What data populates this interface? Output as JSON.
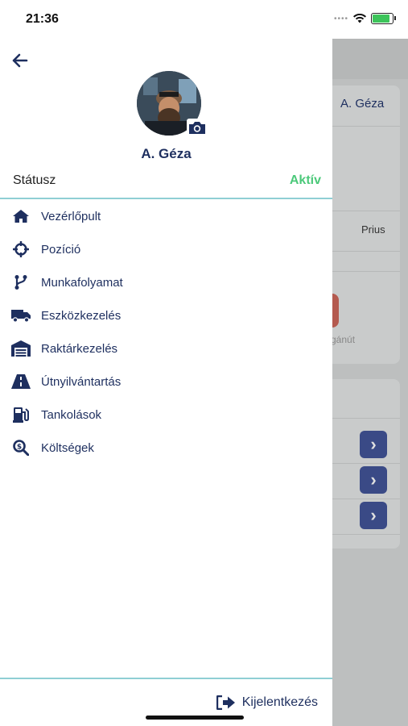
{
  "status_bar": {
    "time": "21:36"
  },
  "drawer": {
    "user_name": "A. Géza",
    "status_label": "Státusz",
    "status_value": "Aktív",
    "menu": [
      {
        "label": "Vezérlőpult",
        "icon": "home-icon"
      },
      {
        "label": "Pozíció",
        "icon": "crosshair-icon"
      },
      {
        "label": "Munkafolyamat",
        "icon": "workflow-icon"
      },
      {
        "label": "Eszközkezelés",
        "icon": "truck-icon"
      },
      {
        "label": "Raktárkezelés",
        "icon": "warehouse-icon"
      },
      {
        "label": "Útnyilvántartás",
        "icon": "road-icon"
      },
      {
        "label": "Tankolások",
        "icon": "fuel-icon"
      },
      {
        "label": "Költségek",
        "icon": "cost-search-icon"
      }
    ],
    "logout_label": "Kijelentkezés"
  },
  "background": {
    "header_name": "A. Géza",
    "vehicle": "Prius",
    "partial_text": "gánút",
    "partial_letter": "i"
  },
  "colors": {
    "primary": "#1e2f5f",
    "status_active": "#4cc97a",
    "divider": "#8fcfd4"
  }
}
